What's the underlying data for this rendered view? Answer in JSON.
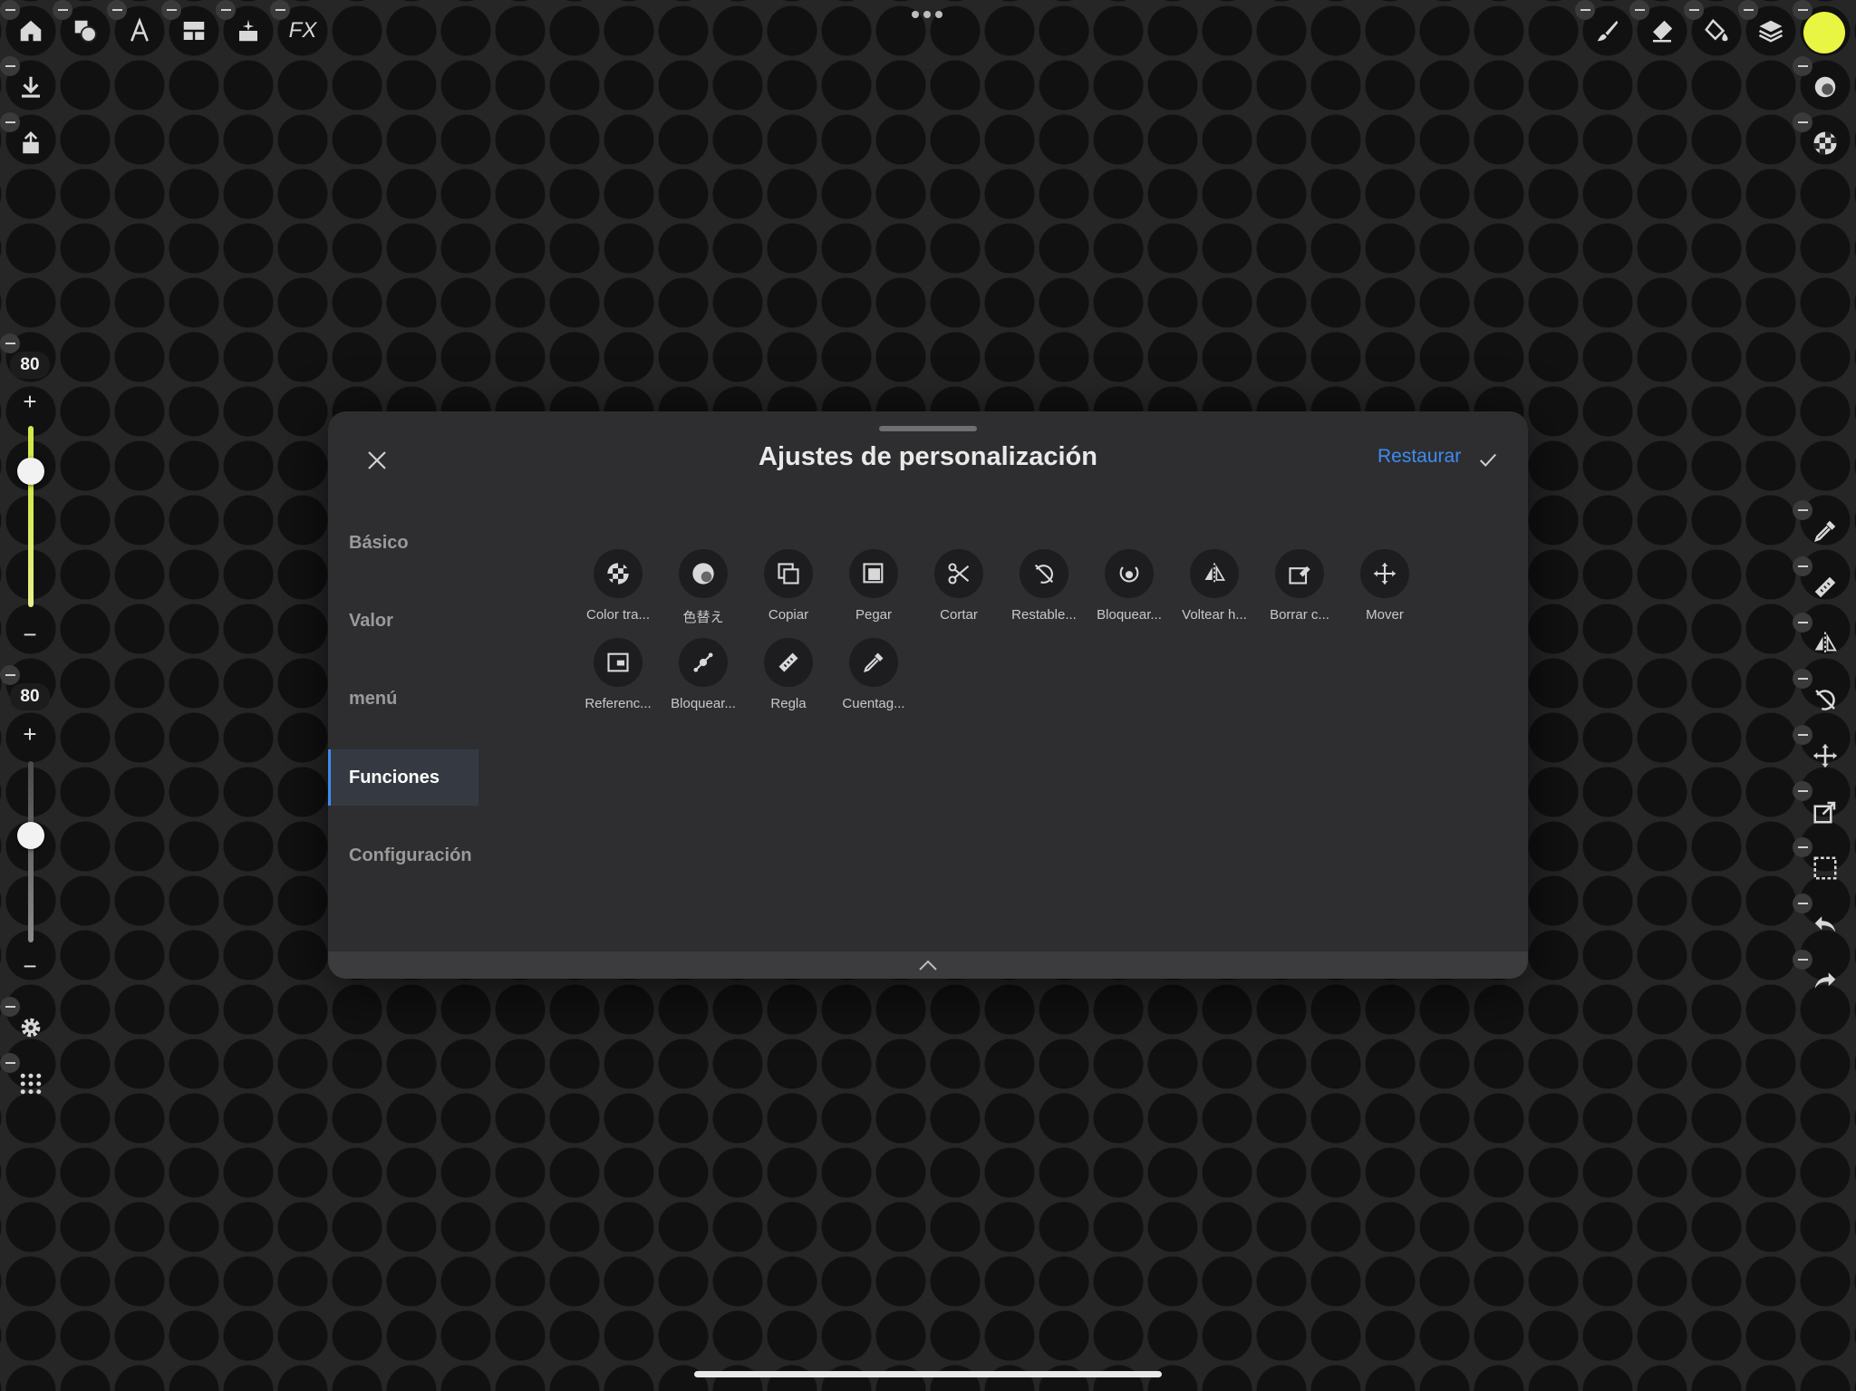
{
  "top_toolbar": {
    "left_icons": [
      "home-icon",
      "shapes-icon",
      "text-icon",
      "layout-icon",
      "sparkle-icon",
      "fx-icon"
    ],
    "fx_label": "FX",
    "right_icons": [
      "brush-icon",
      "eraser-icon",
      "fill-icon",
      "layers-icon"
    ],
    "color": "#e8f542"
  },
  "left_panel": {
    "size_slider": {
      "value": "80",
      "level": 0.8,
      "accent": "#d4e84a"
    },
    "opacity_slider": {
      "value": "80",
      "level": 0.6,
      "accent": "#8a8a8a"
    }
  },
  "dialog": {
    "title": "Ajustes de personalización",
    "restore_label": "Restaurar",
    "accent": "#3d8cf0",
    "sidebar": [
      {
        "label": "Básico",
        "active": false
      },
      {
        "label": "Valor",
        "active": false
      },
      {
        "label": "menú",
        "active": false
      },
      {
        "label": "Funciones",
        "active": true
      },
      {
        "label": "Configuración",
        "active": false
      }
    ],
    "functions": [
      {
        "label": "Color tra...",
        "icon": "checker-icon"
      },
      {
        "label": "色替え",
        "icon": "color-swap-icon"
      },
      {
        "label": "Copiar",
        "icon": "copy-icon"
      },
      {
        "label": "Pegar",
        "icon": "paste-icon"
      },
      {
        "label": "Cortar",
        "icon": "scissors-icon"
      },
      {
        "label": "Restable...",
        "icon": "rotate-reset-icon"
      },
      {
        "label": "Bloquear...",
        "icon": "rotate-lock-icon"
      },
      {
        "label": "Voltear h...",
        "icon": "flip-horizontal-icon"
      },
      {
        "label": "Borrar c...",
        "icon": "clear-layer-icon"
      },
      {
        "label": "Mover",
        "icon": "move-icon"
      },
      {
        "label": "Referenc...",
        "icon": "reference-icon"
      },
      {
        "label": "Bloquear...",
        "icon": "lock-stroke-icon"
      },
      {
        "label": "Regla",
        "icon": "ruler-icon"
      },
      {
        "label": "Cuentag...",
        "icon": "eyedropper-icon"
      }
    ]
  }
}
